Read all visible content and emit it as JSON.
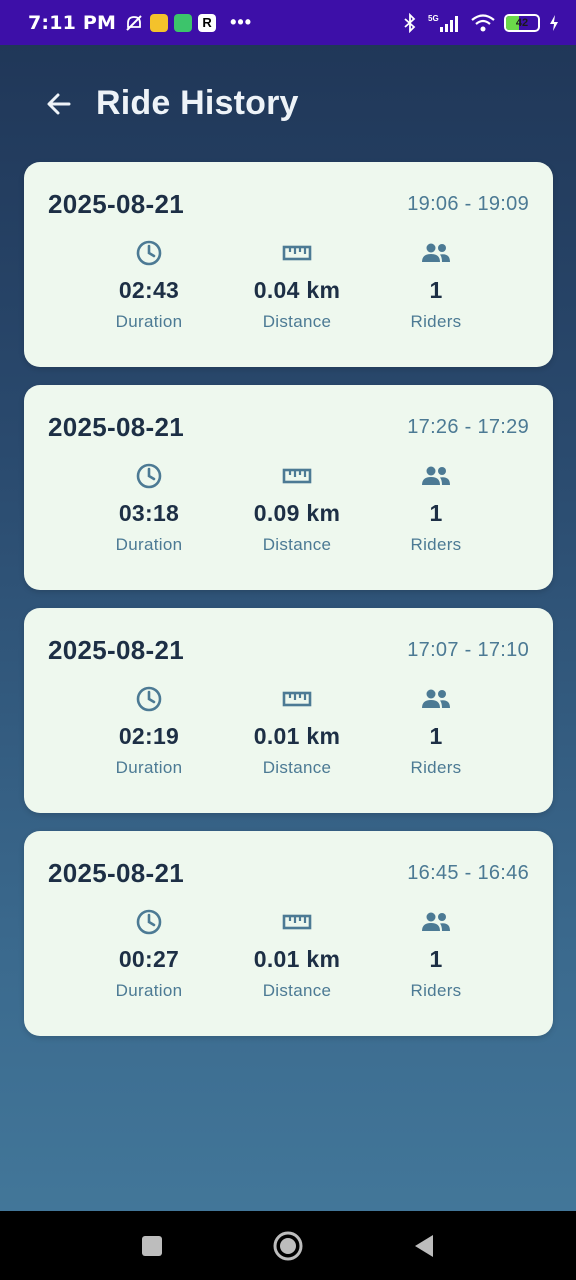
{
  "status_bar": {
    "time": "7:11 PM",
    "dots": "•••",
    "network": "5G",
    "battery": "42",
    "battery_level": 0.42
  },
  "header": {
    "title": "Ride History"
  },
  "labels": {
    "duration": "Duration",
    "distance": "Distance",
    "riders": "Riders"
  },
  "rides": [
    {
      "date": "2025-08-21",
      "time_range": "19:06 - 19:09",
      "duration": "02:43",
      "distance": "0.04 km",
      "riders": "1"
    },
    {
      "date": "2025-08-21",
      "time_range": "17:26 - 17:29",
      "duration": "03:18",
      "distance": "0.09 km",
      "riders": "1"
    },
    {
      "date": "2025-08-21",
      "time_range": "17:07 - 17:10",
      "duration": "02:19",
      "distance": "0.01 km",
      "riders": "1"
    },
    {
      "date": "2025-08-21",
      "time_range": "16:45 - 16:46",
      "duration": "00:27",
      "distance": "0.01 km",
      "riders": "1"
    }
  ],
  "colors": {
    "status_bar": "#3d0fa8",
    "card_bg": "#eef8ee",
    "primary_text": "#1d2f45",
    "secondary_text": "#4c7a94",
    "icon": "#4c7a94"
  }
}
